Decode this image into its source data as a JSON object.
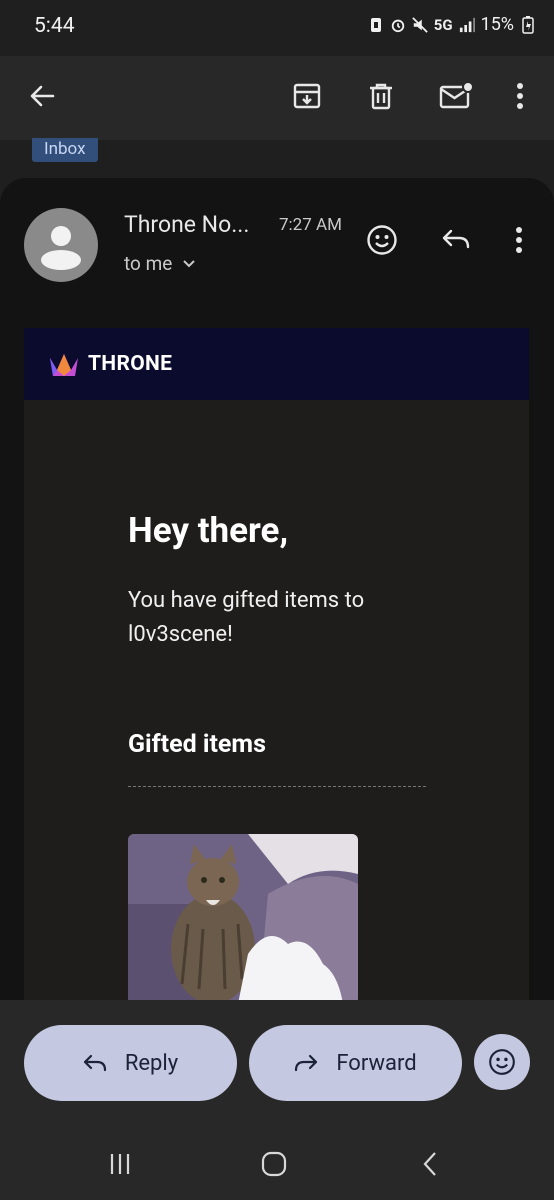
{
  "status_bar": {
    "time": "5:44",
    "network": "5G",
    "battery": "15%"
  },
  "app_bar": {
    "icons": [
      "back-arrow-icon",
      "archive-icon",
      "trash-icon",
      "mark-unread-icon",
      "more-vert-icon"
    ]
  },
  "label": "Inbox",
  "message": {
    "sender": "Throne No...",
    "time": "7:27 AM",
    "recipient": "to me"
  },
  "email_body": {
    "brand_name": "THRONE",
    "greeting": "Hey there,",
    "gift_message": "You have gifted items to l0v3scene!",
    "section_title": "Gifted items"
  },
  "actions": {
    "reply": "Reply",
    "forward": "Forward"
  },
  "colors": {
    "pill_bg": "#c4c8e0",
    "brand_bar": "#0b0b2e",
    "label_chip": "#324f7b"
  }
}
